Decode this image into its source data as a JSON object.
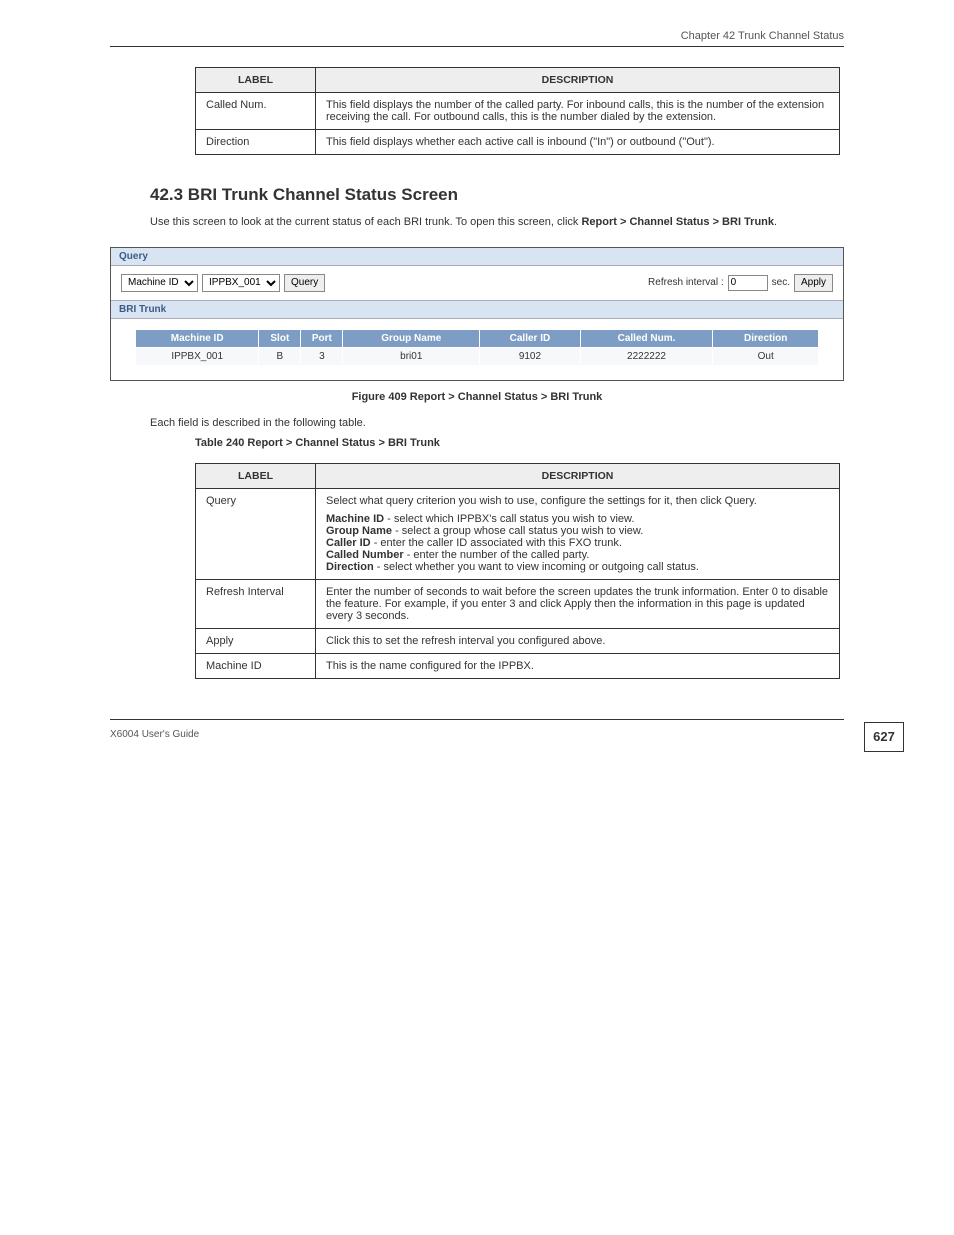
{
  "header": {
    "title": "Chapter 42 Trunk Channel Status"
  },
  "table239": {
    "col_label": "LABEL",
    "col_desc": "DESCRIPTION",
    "rows": [
      {
        "label": "Called Num.",
        "desc": "This field displays the number of the called party. For inbound calls, this is the number of the extension receiving the call. For outbound calls, this is the number dialed by the extension."
      },
      {
        "label": "Direction",
        "desc": "This field displays whether each active call is inbound (\"In\") or outbound (\"Out\")."
      }
    ]
  },
  "section": {
    "number_title": "42.3  BRI Trunk Channel Status Screen",
    "para1": "Use this screen to look at the current status of each BRI trunk. To open this screen, click",
    "para1_path": "Report > Channel Status > BRI Trunk",
    "para1_end": "."
  },
  "screenshot": {
    "query_title": "Query",
    "machine_id_label": "Machine ID",
    "machine_id_value": "IPPBX_001",
    "query_btn": "Query",
    "refresh_label": "Refresh interval :",
    "refresh_value": "0",
    "refresh_unit": "sec.",
    "apply_btn": "Apply",
    "trunk_title": "BRI Trunk",
    "columns": [
      "Machine ID",
      "Slot",
      "Port",
      "Group Name",
      "Caller ID",
      "Called Num.",
      "Direction"
    ],
    "row": [
      "IPPBX_001",
      "B",
      "3",
      "bri01",
      "9102",
      "2222222",
      "Out"
    ]
  },
  "figure_caption": "Figure 409   Report > Channel Status > BRI Trunk",
  "desc_intro": "Each field is described in the following table.",
  "table240": {
    "caption": "Table 240   Report > Channel Status > BRI Trunk",
    "col_label": "LABEL",
    "col_desc": "DESCRIPTION",
    "rows": [
      {
        "label": "Query",
        "desc_lines": [
          "Select what query criterion you wish to use, configure the settings for it, then click Query.",
          "Machine ID - select which IPPBX's call status you wish to view.",
          "Group Name - select a group whose call status you wish to view.",
          "Caller ID - enter the caller ID associated with this FXO trunk.",
          "Called Number - enter the number of the called party.",
          "Direction - select whether you want to view incoming or outgoing call status."
        ]
      },
      {
        "label": "Refresh Interval",
        "desc_lines": [
          "Enter the number of seconds to wait before the screen updates the trunk information. Enter 0 to disable the feature. For example, if you enter 3 and click Apply then the information in this page is updated every 3 seconds."
        ]
      },
      {
        "label": "Apply",
        "desc_lines": [
          "Click this to set the refresh interval you configured above."
        ]
      },
      {
        "label": "Machine ID",
        "desc_lines": [
          "This is the name configured for the IPPBX."
        ]
      }
    ]
  },
  "footer": {
    "text": "X6004 User's Guide",
    "page": "627"
  }
}
